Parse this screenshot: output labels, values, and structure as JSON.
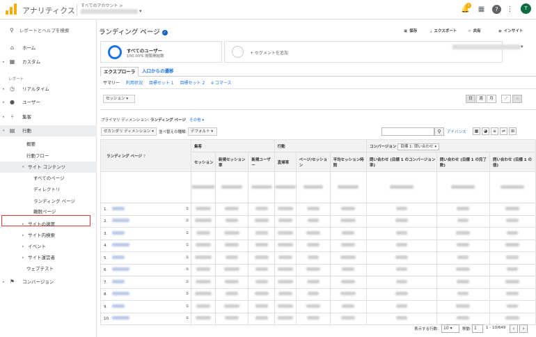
{
  "app": {
    "title": "アナリティクス",
    "account_path": "すべてのアカウント >",
    "notif_count": "2",
    "avatar_letter": "T"
  },
  "sidebar": {
    "search": "レポートとヘルプを検索",
    "home": "ホーム",
    "custom": "カスタム",
    "reports_heading": "レポート",
    "realtime": "リアルタイム",
    "users": "ユーザー",
    "acquisition": "集客",
    "behavior": "行動",
    "overview": "概要",
    "flow": "行動フロー",
    "site_content": "サイト コンテンツ",
    "all_pages": "すべてのページ",
    "directory": "ディレクトリ",
    "landing": "ランディング ページ",
    "exit": "離脱ページ",
    "speed": "サイトの速度",
    "site_search": "サイト内検索",
    "events": "イベント",
    "publisher": "サイト運営者",
    "experiments": "ウェブテスト",
    "conversions": "コンバージョン"
  },
  "main": {
    "title": "ランディング ページ",
    "actions": {
      "save": "保存",
      "export": "エクスポート",
      "share": "共有",
      "insights": "インサイト"
    },
    "segment": {
      "name": "すべてのユーザー",
      "sub": "100.00% 閲覧開始数",
      "add": "+ セグメントを追加"
    },
    "tabs": {
      "explorer": "エクスプローラ",
      "navigation": "入口からの遷移"
    },
    "subtabs": [
      "サマリー",
      "利用状況",
      "目標セット 1",
      "目標セット 2",
      "e コマース"
    ],
    "session_dd": "セッション",
    "views": {
      "day": "日",
      "week": "週",
      "month": "月"
    },
    "primary_dim": "プライマリ ディメンション:",
    "primary_val": "ランディング ページ",
    "other": "その他",
    "secondary_dd": "セカンダリ ディメンション",
    "sort_type_label": "並べ替えの種類:",
    "sort_dd": "デフォルト",
    "advanced": "アドバンス"
  },
  "table": {
    "col_landing": "ランディング ページ",
    "grp_acq": "集客",
    "grp_beh": "行動",
    "grp_conv": "コンバージョン",
    "goal_dd": "目標 1: 問い合わせ",
    "cols": [
      "セッション",
      "新規セッション率",
      "新規ユーザー",
      "直帰率",
      "ページ/セッション",
      "平均セッション時間",
      "問い合わせ (目標 1 のコンバージョン率)",
      "問い合わせ (目標 1 の完了数)",
      "問い合わせ (目標 1 の値)"
    ],
    "rows": [
      "1.",
      "2.",
      "3.",
      "4.",
      "5.",
      "6.",
      "7.",
      "8.",
      "9.",
      "10."
    ]
  },
  "pager": {
    "rows_label": "表示する行数:",
    "rows_value": "10",
    "goto_label": "移動:",
    "goto_value": "1",
    "range": "1 - 10/649"
  }
}
